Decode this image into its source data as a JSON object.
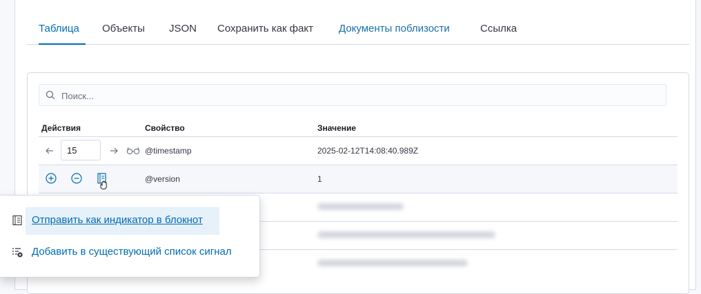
{
  "tabs": [
    {
      "label": "Таблица"
    },
    {
      "label": "Объекты"
    },
    {
      "label": "JSON"
    },
    {
      "label": "Сохранить как факт"
    },
    {
      "label": "Документы поблизости"
    },
    {
      "label": "Ссылка"
    }
  ],
  "search": {
    "placeholder": "Поиск...",
    "icon": "search-icon"
  },
  "table": {
    "headers": {
      "actions": "Действия",
      "property": "Свойство",
      "value": "Значение"
    },
    "rows": [
      {
        "property": "@timestamp",
        "value": "2025-02-12T14:08:40.989Z"
      },
      {
        "property": "@version",
        "value": "1"
      }
    ],
    "pagination": {
      "page": "15"
    }
  },
  "row_icons": [
    "arrow-left-icon",
    "arrow-right-icon",
    "glasses-icon",
    "plus-circle-icon",
    "minus-circle-icon",
    "notebook-icon"
  ],
  "popover": {
    "items": [
      {
        "label": "Отправить как индикатор в блокнот",
        "icon": "notebook-icon"
      },
      {
        "label": "Добавить в существующий список сигнал",
        "icon": "list-add-icon"
      }
    ]
  },
  "colors": {
    "accent": "#006bb4",
    "border": "#d3dae6"
  }
}
